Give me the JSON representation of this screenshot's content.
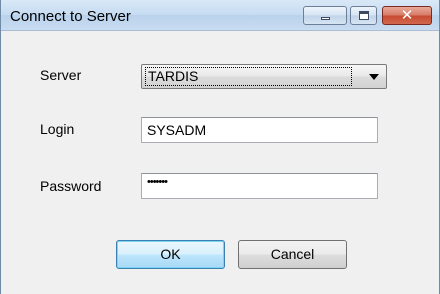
{
  "window": {
    "title": "Connect to Server",
    "controls": {
      "minimize_icon": "minimize-icon",
      "maximize_icon": "maximize-icon",
      "close_icon": "close-icon",
      "close_glyph": "✕"
    }
  },
  "form": {
    "server_label": "Server",
    "server_value": "TARDIS",
    "login_label": "Login",
    "login_value": "SYSADM",
    "password_label": "Password",
    "password_mask": "•••••••"
  },
  "buttons": {
    "ok_label": "OK",
    "cancel_label": "Cancel"
  },
  "colors": {
    "titlebar": "#c6dcf1",
    "close_button": "#c64a2f",
    "default_button_border": "#3c7fb1",
    "window_background": "#f0f0f0"
  }
}
